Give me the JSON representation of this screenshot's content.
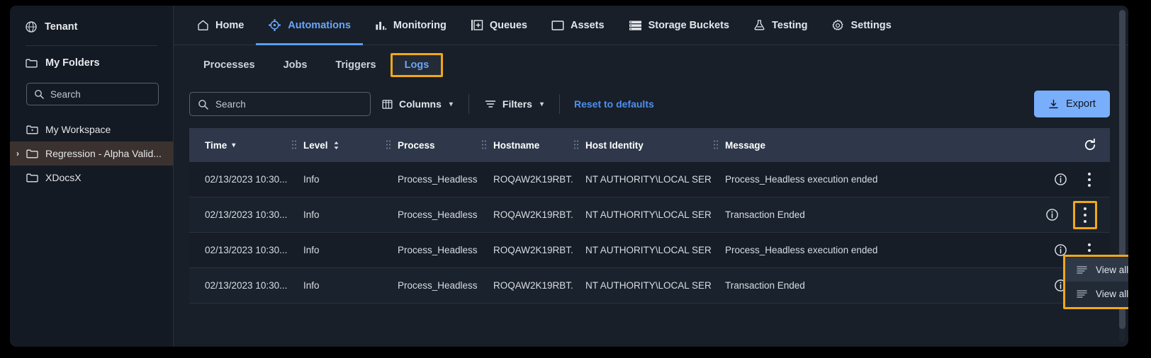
{
  "sidebar": {
    "tenant_label": "Tenant",
    "tenant_icon": "globe-icon",
    "my_folders_label": "My Folders",
    "my_folders_icon": "folder-icon",
    "search_placeholder": "Search",
    "search_icon": "search-icon",
    "folders": [
      {
        "label": "My Workspace",
        "icon": "folder-star-icon",
        "selected": false,
        "expandable": false
      },
      {
        "label": "Regression - Alpha Valid...",
        "icon": "folder-icon",
        "selected": true,
        "expandable": true
      },
      {
        "label": "XDocsX",
        "icon": "folder-icon",
        "selected": false,
        "expandable": false
      }
    ]
  },
  "topnav": {
    "items": [
      {
        "label": "Home",
        "icon": "home-icon",
        "active": false
      },
      {
        "label": "Automations",
        "icon": "automations-gear-icon",
        "active": true
      },
      {
        "label": "Monitoring",
        "icon": "bar-chart-icon",
        "active": false
      },
      {
        "label": "Queues",
        "icon": "queue-plus-icon",
        "active": false
      },
      {
        "label": "Assets",
        "icon": "square-icon",
        "active": false
      },
      {
        "label": "Storage Buckets",
        "icon": "storage-stack-icon",
        "active": false
      },
      {
        "label": "Testing",
        "icon": "flask-icon",
        "active": false
      },
      {
        "label": "Settings",
        "icon": "gear-icon",
        "active": false
      }
    ]
  },
  "subtabs": {
    "items": [
      {
        "label": "Processes",
        "active": false,
        "highlighted": false
      },
      {
        "label": "Jobs",
        "active": false,
        "highlighted": false
      },
      {
        "label": "Triggers",
        "active": false,
        "highlighted": false
      },
      {
        "label": "Logs",
        "active": true,
        "highlighted": true
      }
    ]
  },
  "toolbar": {
    "search_placeholder": "Search",
    "search_icon": "search-icon",
    "columns_label": "Columns",
    "columns_icon": "columns-icon",
    "columns_chevron": "chevron-down-icon",
    "filters_label": "Filters",
    "filters_icon": "filter-icon",
    "filters_chevron": "chevron-down-icon",
    "reset_label": "Reset to defaults",
    "export_label": "Export",
    "export_icon": "download-icon",
    "accent_color": "#79aefb",
    "link_color": "#4f8ff0"
  },
  "table": {
    "refresh_icon": "refresh-icon",
    "columns": [
      {
        "key": "time",
        "label": "Time",
        "sort_icon": "chevron-down-icon"
      },
      {
        "key": "level",
        "label": "Level",
        "sort_icon": "sort-updown-icon"
      },
      {
        "key": "process",
        "label": "Process",
        "sort_icon": ""
      },
      {
        "key": "hostname",
        "label": "Hostname",
        "sort_icon": ""
      },
      {
        "key": "identity",
        "label": "Host Identity",
        "sort_icon": ""
      },
      {
        "key": "message",
        "label": "Message",
        "sort_icon": ""
      }
    ],
    "rows": [
      {
        "time": "02/13/2023 10:30...",
        "level": "Info",
        "process": "Process_Headless",
        "hostname": "ROQAW2K19RBT...",
        "identity": "NT AUTHORITY\\LOCAL SER...",
        "message": "Process_Headless execution ended",
        "info_icon": "info-circle-icon",
        "menu_icon": "kebab-menu-icon",
        "menu_highlighted": false
      },
      {
        "time": "02/13/2023 10:30...",
        "level": "Info",
        "process": "Process_Headless",
        "hostname": "ROQAW2K19RBT...",
        "identity": "NT AUTHORITY\\LOCAL SER...",
        "message": "Transaction Ended",
        "info_icon": "info-circle-icon",
        "menu_icon": "kebab-menu-icon",
        "menu_highlighted": true
      },
      {
        "time": "02/13/2023 10:30...",
        "level": "Info",
        "process": "Process_Headless",
        "hostname": "ROQAW2K19RBT...",
        "identity": "NT AUTHORITY\\LOCAL SER...",
        "message": "Process_Headless execution ended",
        "info_icon": "info-circle-icon",
        "menu_icon": "kebab-menu-icon",
        "menu_highlighted": false
      },
      {
        "time": "02/13/2023 10:30...",
        "level": "Info",
        "process": "Process_Headless",
        "hostname": "ROQAW2K19RBT...",
        "identity": "NT AUTHORITY\\LOCAL SER...",
        "message": "Transaction Ended",
        "info_icon": "info-circle-icon",
        "menu_icon": "kebab-menu-icon",
        "menu_highlighted": false
      }
    ]
  },
  "context_menu": {
    "highlight_color": "#f0a818",
    "items": [
      {
        "label": "View all logs for this job",
        "icon": "list-icon",
        "hover": true
      },
      {
        "label": "View all logs for this process",
        "icon": "list-icon",
        "hover": false
      }
    ]
  }
}
